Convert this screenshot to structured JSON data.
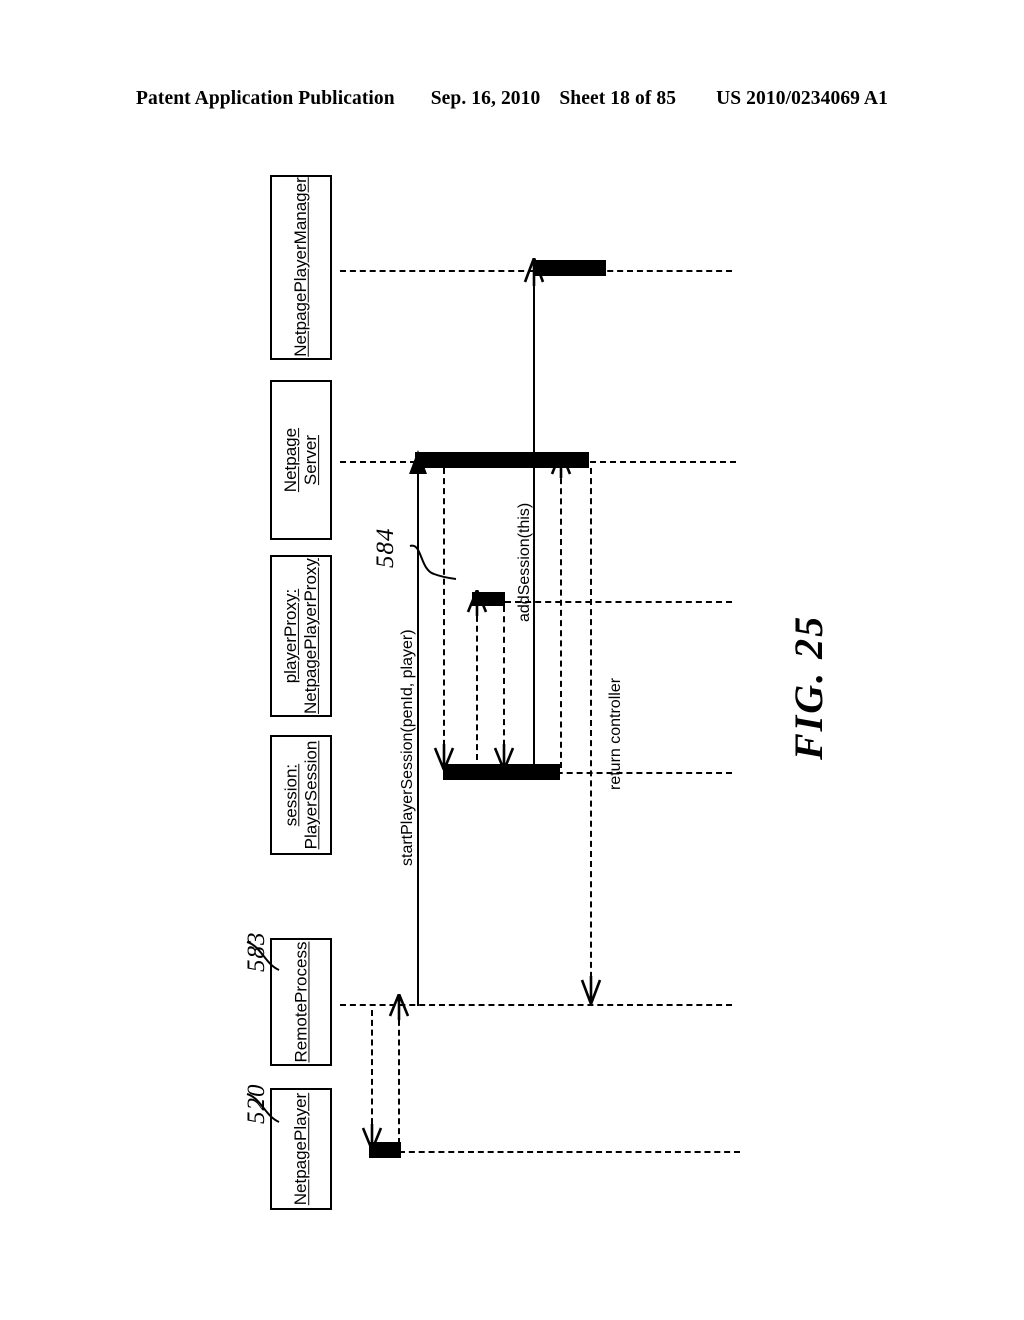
{
  "header": {
    "publication": "Patent Application Publication",
    "date": "Sep. 16, 2010",
    "sheet": "Sheet 18 of 85",
    "docnum": "US 2010/0234069 A1"
  },
  "figure": {
    "label": "FIG. 25",
    "type": "uml-sequence-diagram"
  },
  "participants": [
    {
      "id": "netpage-player-manager",
      "line1": "NetpagePlayerManager",
      "line2": ""
    },
    {
      "id": "netpage-server",
      "line1": "Netpage",
      "line2": "Server"
    },
    {
      "id": "player-proxy",
      "line1": "playerProxy:",
      "line2": "NetpagePlayerProxy"
    },
    {
      "id": "session",
      "line1": "session:",
      "line2": "PlayerSession"
    },
    {
      "id": "remote-process",
      "line1": "RemoteProcess",
      "line2": ""
    },
    {
      "id": "netpage-player",
      "line1": "NetpagePlayer",
      "line2": ""
    }
  ],
  "messages": [
    {
      "id": "start-player-session",
      "label": "startPlayerSession(penId, player)"
    },
    {
      "id": "add-session",
      "label": "addSession(this)"
    },
    {
      "id": "return-controller",
      "label": "return controller"
    }
  ],
  "reference_numerals": [
    {
      "id": "ref-583",
      "value": "583"
    },
    {
      "id": "ref-520",
      "value": "520"
    },
    {
      "id": "ref-584",
      "value": "584"
    }
  ],
  "colors": {
    "ink": "#000000",
    "paper": "#ffffff"
  }
}
